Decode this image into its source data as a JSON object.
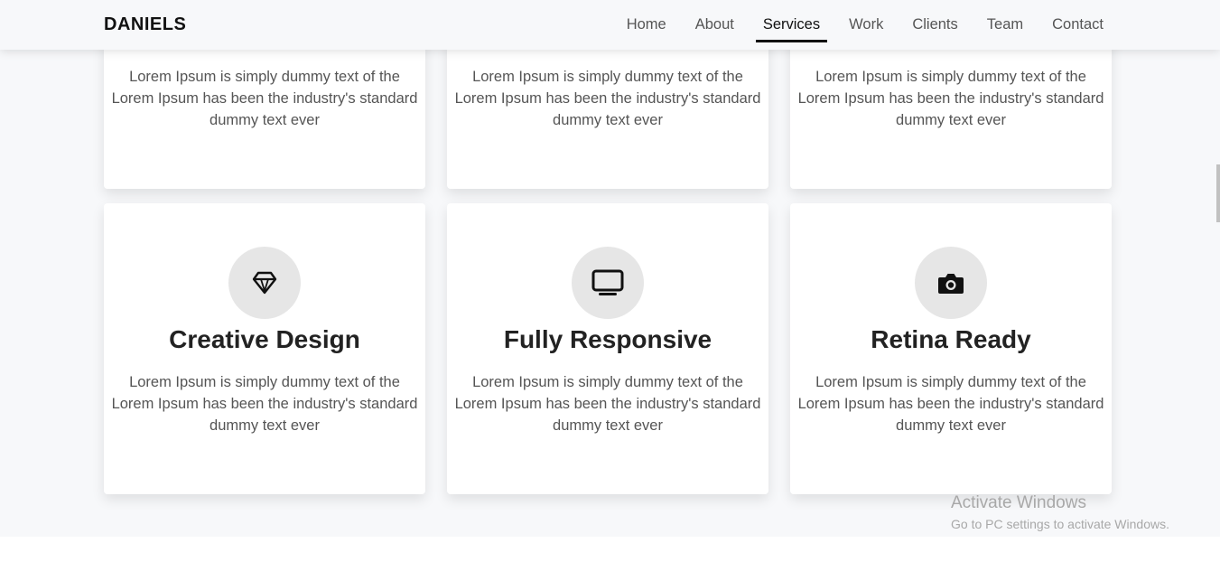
{
  "brand": "DANIELS",
  "nav": [
    {
      "label": "Home",
      "active": false
    },
    {
      "label": "About",
      "active": false
    },
    {
      "label": "Services",
      "active": true
    },
    {
      "label": "Work",
      "active": false
    },
    {
      "label": "Clients",
      "active": false
    },
    {
      "label": "Team",
      "active": false
    },
    {
      "label": "Contact",
      "active": false
    }
  ],
  "top_cards": [
    {
      "text": "Lorem Ipsum is simply dummy text of the Lorem Ipsum has been the industry's standard dummy text ever"
    },
    {
      "text": "Lorem Ipsum is simply dummy text of the Lorem Ipsum has been the industry's standard dummy text ever"
    },
    {
      "text": "Lorem Ipsum is simply dummy text of the Lorem Ipsum has been the industry's standard dummy text ever"
    }
  ],
  "bottom_cards": [
    {
      "icon": "diamond-icon",
      "title": "Creative Design",
      "text": "Lorem Ipsum is simply dummy text of the Lorem Ipsum has been the industry's standard dummy text ever"
    },
    {
      "icon": "monitor-icon",
      "title": "Fully Responsive",
      "text": "Lorem Ipsum is simply dummy text of the Lorem Ipsum has been the industry's standard dummy text ever"
    },
    {
      "icon": "camera-icon",
      "title": "Retina Ready",
      "text": "Lorem Ipsum is simply dummy text of the Lorem Ipsum has been the industry's standard dummy text ever"
    }
  ],
  "watermark": {
    "title": "Activate Windows",
    "subtitle": "Go to PC settings to activate Windows."
  },
  "colors": {
    "background": "#f7f8fa",
    "card": "#ffffff",
    "icon_circle": "#e6e6e6",
    "text": "#555555",
    "heading": "#222222",
    "active_nav": "#111111"
  }
}
